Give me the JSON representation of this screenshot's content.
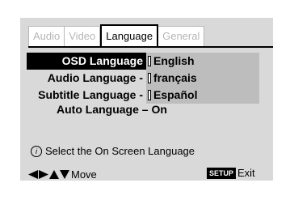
{
  "tabs": [
    {
      "label": "Audio",
      "active": false
    },
    {
      "label": "Video",
      "active": false
    },
    {
      "label": "Language",
      "active": true
    },
    {
      "label": "General",
      "active": false
    }
  ],
  "settings": [
    {
      "label": "OSD Language",
      "value": "English",
      "selected": true
    },
    {
      "label": "Audio Language -",
      "value": "français",
      "selected": false
    },
    {
      "label": "Subtitle Language -",
      "value": "Español",
      "selected": false
    }
  ],
  "auto_language": {
    "label": "Auto Language – On"
  },
  "info": {
    "text": "Select the On Screen Language",
    "icon": "info-icon"
  },
  "footer": {
    "move_label": "Move",
    "setup_badge": "SETUP",
    "exit_label": "Exit"
  },
  "colors": {
    "panel": "#d9d9d9",
    "value_bg": "#bdbdbd",
    "selected_bg": "#000000",
    "inactive_tab_text": "#b5b5b5"
  }
}
